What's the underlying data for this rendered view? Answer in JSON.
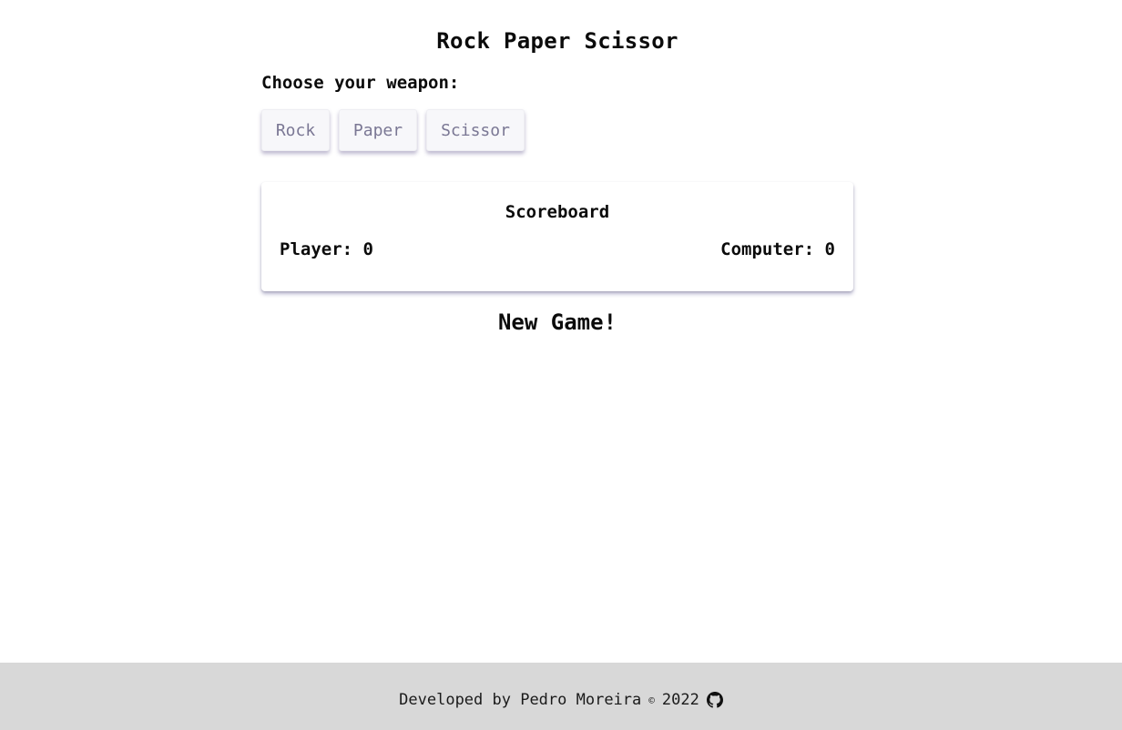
{
  "header": {
    "title": "Rock Paper Scissor"
  },
  "game": {
    "prompt": "Choose your weapon:",
    "weapons": {
      "rock": "Rock",
      "paper": "Paper",
      "scissor": "Scissor"
    },
    "new_game_label": "New Game!"
  },
  "scoreboard": {
    "title": "Scoreboard",
    "player_label": "Player: 0",
    "computer_label": "Computer: 0"
  },
  "footer": {
    "developed_by": "Developed by Pedro Moreira",
    "copyright_symbol": "©",
    "year": "2022",
    "github_icon": "github-icon"
  },
  "colors": {
    "button_text": "#7a7794",
    "footer_bg": "#d8d8d8"
  }
}
